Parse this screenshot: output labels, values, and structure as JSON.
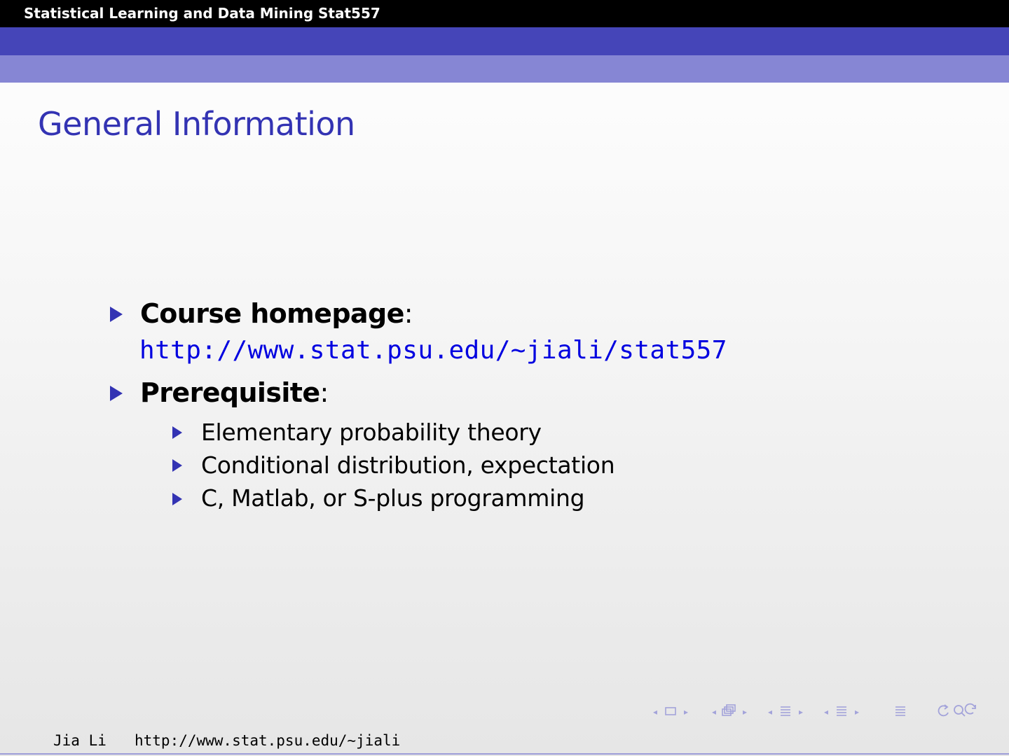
{
  "header": {
    "course_title": "Statistical Learning and Data Mining",
    "course_code": "Stat557"
  },
  "slide": {
    "title": "General Information",
    "items": [
      {
        "label": "Course homepage",
        "suffix": ":",
        "url": "http://www.stat.psu.edu/~jiali/stat557"
      },
      {
        "label": "Prerequisite",
        "suffix": ":",
        "subitems": [
          "Elementary probability theory",
          "Conditional distribution, expectation",
          "C, Matlab, or S-plus programming"
        ]
      }
    ]
  },
  "footer": {
    "author": "Jia Li",
    "website": "http://www.stat.psu.edu/∼jiali"
  },
  "nav_icons": [
    "prev-frame-arrow-icon",
    "frame-icon",
    "next-frame-arrow-icon",
    "prev-subsection-arrow-icon",
    "subsection-icon",
    "next-subsection-arrow-icon",
    "prev-section-arrow-icon",
    "section-icon",
    "next-section-arrow-icon",
    "prev-part-arrow-icon",
    "part-icon",
    "next-part-arrow-icon",
    "back-icon",
    "search-icon",
    "forward-icon"
  ],
  "colors": {
    "title_blue": "#3333b3",
    "band_dark": "#4545b8",
    "band_light": "#8686d4",
    "link_blue": "#0000e0",
    "nav_gray_blue": "#a3a3da"
  }
}
